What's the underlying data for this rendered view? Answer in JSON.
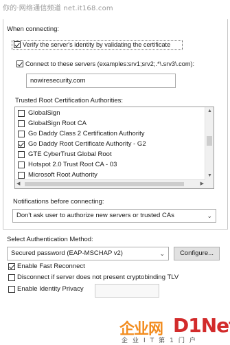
{
  "watermark": {
    "top_text": "你的·网络通信频道 net.it168.com",
    "logo_left": "企业网",
    "logo_right": "D1Net",
    "logo_sub": "企业IT第1门户"
  },
  "when_connecting": {
    "label": "When connecting:",
    "verify_identity": {
      "label": "Verify the server's identity by validating the certificate",
      "checked": true
    },
    "connect_servers": {
      "label": "Connect to these servers (examples:srv1;srv2;.*\\.srv3\\.com):",
      "checked": true
    },
    "servers_value": "nowiresecurity.com"
  },
  "trusted_roots": {
    "label": "Trusted Root Certification Authorities:",
    "items": [
      {
        "label": "GlobalSign",
        "checked": false
      },
      {
        "label": "GlobalSign Root CA",
        "checked": false
      },
      {
        "label": "Go Daddy Class 2 Certification Authority",
        "checked": false
      },
      {
        "label": "Go Daddy Root Certificate Authority - G2",
        "checked": true
      },
      {
        "label": "GTE CyberTrust Global Root",
        "checked": false
      },
      {
        "label": "Hotspot 2.0 Trust Root CA - 03",
        "checked": false
      },
      {
        "label": "Microsoft Root Authority",
        "checked": false
      }
    ]
  },
  "notifications": {
    "label": "Notifications before connecting:",
    "selected": "Don't ask user to authorize new servers or trusted CAs"
  },
  "auth_method": {
    "label": "Select Authentication Method:",
    "selected": "Secured password (EAP-MSCHAP v2)",
    "configure_label": "Configure..."
  },
  "options": {
    "fast_reconnect": {
      "label": "Enable Fast Reconnect",
      "checked": true
    },
    "cryptobinding": {
      "label": "Disconnect if server does not present cryptobinding TLV",
      "checked": false
    },
    "identity_privacy": {
      "label": "Enable Identity Privacy",
      "checked": false
    }
  }
}
